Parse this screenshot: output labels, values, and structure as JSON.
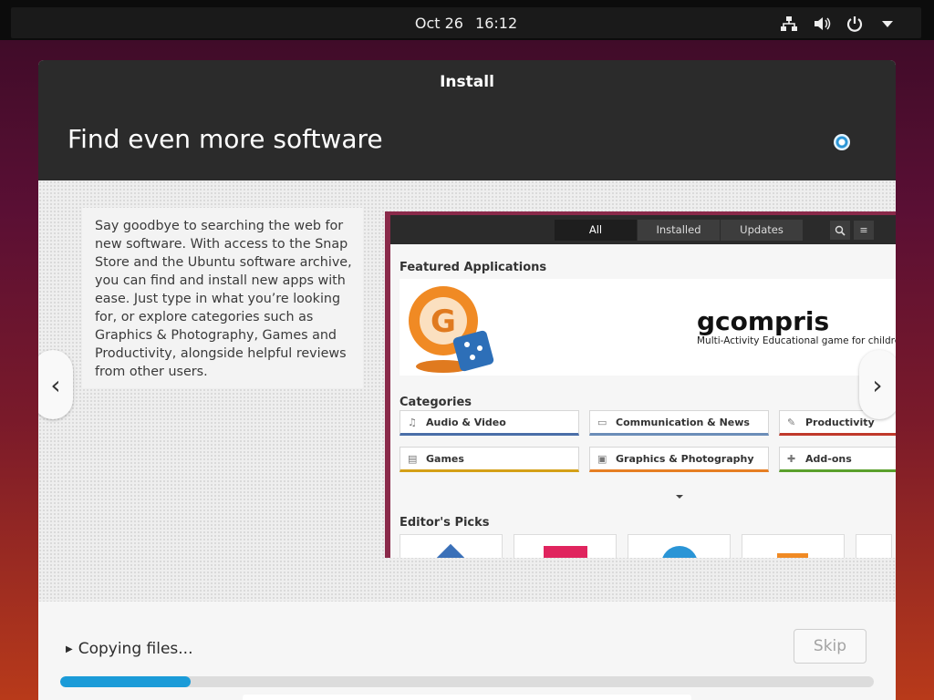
{
  "topbar": {
    "date": "Oct 26",
    "time": "16:12",
    "icons": [
      "network-icon",
      "volume-icon",
      "power-icon",
      "menu-arrow-icon"
    ]
  },
  "window": {
    "title": "Install",
    "page_title": "Find even more software"
  },
  "slide": {
    "description": "Say goodbye to searching the web for new software. With access to the Snap Store and the Ubuntu software archive, you can find and install new apps with ease. Just type in what you’re looking for, or explore categories such as Graphics & Photography, Games and Productivity, alongside helpful reviews from other users.",
    "prev_icon": "‹",
    "next_icon": "›"
  },
  "software_app": {
    "tabs": [
      "All",
      "Installed",
      "Updates"
    ],
    "featured_heading": "Featured Applications",
    "featured_name": "gcompris",
    "featured_tagline": "Multi-Activity Educational game for children",
    "categories_heading": "Categories",
    "categories": [
      {
        "label": "Audio & Video",
        "icon": "♫",
        "color": "#4a6ea8"
      },
      {
        "label": "Communication & News",
        "icon": "▭",
        "color": "#6b8db8"
      },
      {
        "label": "Productivity",
        "icon": "✎",
        "color": "#c0392b"
      },
      {
        "label": "Games",
        "icon": "▤",
        "color": "#d4a017"
      },
      {
        "label": "Graphics & Photography",
        "icon": "▣",
        "color": "#e67e22"
      },
      {
        "label": "Add-ons",
        "icon": "✚",
        "color": "#5aa02c"
      }
    ],
    "editors_heading": "Editor's Picks"
  },
  "footer": {
    "status": "Copying files...",
    "skip_label": "Skip",
    "progress": 0.16
  },
  "colors": {
    "accent": "#1b9bd8",
    "header_bg": "#2b2b2b"
  }
}
